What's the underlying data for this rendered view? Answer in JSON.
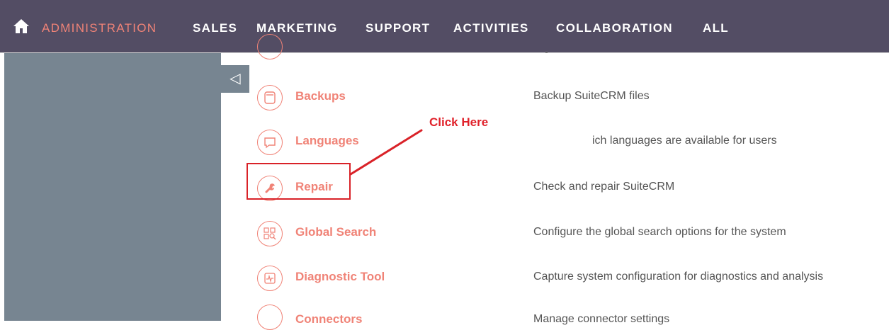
{
  "nav": {
    "items": [
      {
        "label": "ADMINISTRATION",
        "state": "active"
      },
      {
        "label": "SALES"
      },
      {
        "label": "MARKETING"
      },
      {
        "label": "SUPPORT"
      },
      {
        "label": "ACTIVITIES"
      },
      {
        "label": "COLLABORATION"
      },
      {
        "label": "ALL"
      }
    ],
    "home_icon": "home-icon"
  },
  "sidebar": {
    "collapse_icon": "collapse-left-icon",
    "collapse_glyph": "◁"
  },
  "admin_rows": [
    {
      "title": "Backups",
      "description": "Backup SuiteCRM files",
      "icon": "backups-icon"
    },
    {
      "title": "Languages",
      "description": "ich languages are available for users",
      "icon": "languages-icon"
    },
    {
      "title": "Repair",
      "description": "Check and repair SuiteCRM",
      "icon": "repair-icon"
    },
    {
      "title": "Global Search",
      "description": "Configure the global search options for the system",
      "icon": "global-search-icon"
    },
    {
      "title": "Diagnostic Tool",
      "description": "Capture system configuration for diagnostics and analysis",
      "icon": "diagnostic-tool-icon"
    },
    {
      "title": "Connectors",
      "description": "Manage connector settings",
      "icon": "connectors-icon"
    }
  ],
  "annotation": {
    "callout_text": "Click Here"
  },
  "colors": {
    "topbar": "#534d64",
    "sidebar": "#778591",
    "accent": "#f08377",
    "highlight": "#d92228"
  }
}
